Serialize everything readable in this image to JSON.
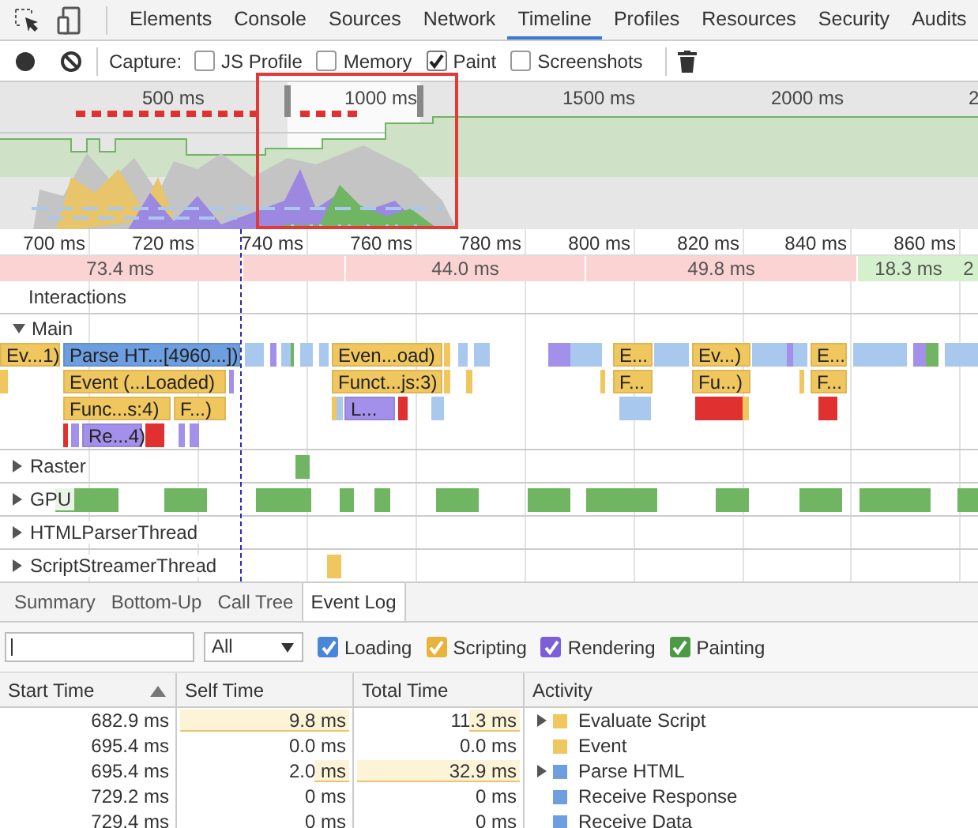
{
  "devtools_tabs": [
    {
      "label": "Elements",
      "selected": false
    },
    {
      "label": "Console",
      "selected": false
    },
    {
      "label": "Sources",
      "selected": false
    },
    {
      "label": "Network",
      "selected": false
    },
    {
      "label": "Timeline",
      "selected": true
    },
    {
      "label": "Profiles",
      "selected": false
    },
    {
      "label": "Resources",
      "selected": false
    },
    {
      "label": "Security",
      "selected": false
    },
    {
      "label": "Audits",
      "selected": false
    }
  ],
  "toolbar": {
    "capture_label": "Capture:",
    "options": [
      {
        "label": "JS Profile",
        "checked": false
      },
      {
        "label": "Memory",
        "checked": false
      },
      {
        "label": "Paint",
        "checked": true
      },
      {
        "label": "Screenshots",
        "checked": false
      }
    ]
  },
  "overview": {
    "ticks": [
      "500 ms",
      "1000 ms",
      "1500 ms",
      "2000 ms",
      "2"
    ]
  },
  "ruler": {
    "ticks": [
      "700 ms",
      "720 ms",
      "740 ms",
      "760 ms",
      "780 ms",
      "800 ms",
      "820 ms",
      "840 ms",
      "860 ms"
    ]
  },
  "frames": [
    {
      "duration": "73.4 ms",
      "kind": "long"
    },
    {
      "duration": "44.0 ms",
      "kind": "long"
    },
    {
      "duration": "49.8 ms",
      "kind": "long"
    },
    {
      "duration": "18.3 ms",
      "kind": "short"
    },
    {
      "duration": "2",
      "kind": "short"
    }
  ],
  "interactions": {
    "label": "Interactions"
  },
  "main": {
    "label": "Main",
    "expanded": true,
    "events": [
      {
        "label": "Ev...1)",
        "kind": "scripting"
      },
      {
        "label": "Parse HT...[4960...])",
        "kind": "loading",
        "children": [
          {
            "label": "Event (...Loaded)",
            "kind": "scripting",
            "children": [
              {
                "label": "Func...s:4)",
                "kind": "scripting",
                "children": [
                  {
                    "label": "Re...4)",
                    "kind": "rendering"
                  }
                ]
              },
              {
                "label": "F...)",
                "kind": "scripting"
              }
            ]
          }
        ]
      },
      {
        "label": "Even...oad)",
        "kind": "scripting",
        "children": [
          {
            "label": "Funct...js:3)",
            "kind": "scripting",
            "children": [
              {
                "label": "L...",
                "kind": "rendering"
              }
            ]
          }
        ]
      },
      {
        "label": "E...",
        "kind": "scripting",
        "children": [
          {
            "label": "F...",
            "kind": "scripting"
          }
        ]
      },
      {
        "label": "Ev...)",
        "kind": "scripting",
        "children": [
          {
            "label": "Fu...)",
            "kind": "scripting"
          }
        ]
      },
      {
        "label": "E...",
        "kind": "scripting",
        "children": [
          {
            "label": "F...",
            "kind": "scripting"
          }
        ]
      }
    ]
  },
  "threads": [
    {
      "name": "Raster",
      "expanded": false
    },
    {
      "name": "GPU",
      "expanded": false
    },
    {
      "name": "HTMLParserThread",
      "expanded": false
    },
    {
      "name": "ScriptStreamerThread",
      "expanded": false
    }
  ],
  "detail_tabs": [
    {
      "label": "Summary",
      "selected": false
    },
    {
      "label": "Bottom-Up",
      "selected": false
    },
    {
      "label": "Call Tree",
      "selected": false
    },
    {
      "label": "Event Log",
      "selected": true
    }
  ],
  "filter": {
    "type": "All",
    "categories": [
      {
        "label": "Loading",
        "checked": true,
        "color": "#4a86d8"
      },
      {
        "label": "Scripting",
        "checked": true,
        "color": "#e8b33a"
      },
      {
        "label": "Rendering",
        "checked": true,
        "color": "#7c5fd6"
      },
      {
        "label": "Painting",
        "checked": true,
        "color": "#4c9a45"
      }
    ]
  },
  "table": {
    "columns": [
      {
        "label": "Start Time",
        "sorted": true
      },
      {
        "label": "Self Time",
        "sorted": false
      },
      {
        "label": "Total Time",
        "sorted": false
      },
      {
        "label": "Activity",
        "sorted": false
      }
    ],
    "rows": [
      {
        "start": "682.9 ms",
        "self": {
          "text": "9.8 ms",
          "level": 1
        },
        "total": {
          "text": "11.3 ms",
          "level": 0.3
        },
        "expandable": true,
        "color": "#f0c75e",
        "activity": "Evaluate Script"
      },
      {
        "start": "695.4 ms",
        "self": {
          "text": "0.0 ms"
        },
        "total": {
          "text": "0.0 ms"
        },
        "expandable": false,
        "color": "#f0c75e",
        "activity": "Event"
      },
      {
        "start": "695.4 ms",
        "self": {
          "text": "2.0 ms",
          "level": 0.2
        },
        "total": {
          "text": "32.9 ms",
          "level": 1
        },
        "expandable": true,
        "color": "#6d9ee0",
        "activity": "Parse HTML"
      },
      {
        "start": "729.2 ms",
        "self": {
          "text": "0 ms"
        },
        "total": {
          "text": "0 ms"
        },
        "expandable": false,
        "color": "#6d9ee0",
        "activity": "Receive Response"
      },
      {
        "start": "729.4 ms",
        "self": {
          "text": "0 ms"
        },
        "total": {
          "text": "0 ms"
        },
        "expandable": false,
        "color": "#6d9ee0",
        "activity": "Receive Data"
      }
    ]
  }
}
